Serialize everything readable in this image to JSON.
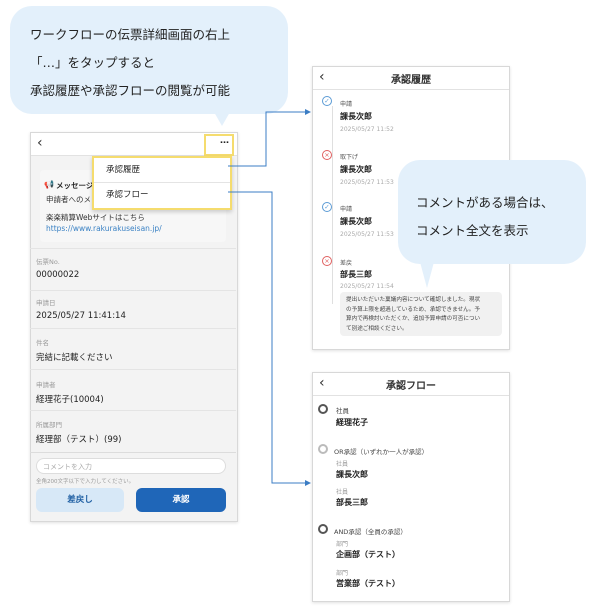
{
  "callouts": {
    "top": [
      "ワークフローの伝票詳細画面の右上",
      "「…」をタップすると",
      "承認履歴や承認フローの閲覧が可能"
    ],
    "right": [
      "コメントがある場合は、",
      "コメント全文を表示"
    ]
  },
  "detail": {
    "back_icon": "‹",
    "more_label": "…",
    "menu": [
      "承認履歴",
      "承認フロー"
    ],
    "message_title": "メッセージ",
    "message_body": "申請者へのメッ",
    "message_note": "楽楽精算Webサイトはこちら",
    "message_link": "https://www.rakurakuseisan.jp/",
    "fields": [
      {
        "label": "伝票No.",
        "value": "00000022"
      },
      {
        "label": "申請日",
        "value": "2025/05/27 11:41:14"
      },
      {
        "label": "件名",
        "value": "完結に記載ください"
      },
      {
        "label": "申請者",
        "value": "経理花子(10004)"
      },
      {
        "label": "所属部門",
        "value": "経理部（テスト）(99)"
      }
    ],
    "comment_placeholder": "コメントを入力",
    "comment_hint": "全角200文字以下で入力してください。",
    "reject_button": "差戻し",
    "approve_button": "承認"
  },
  "history": {
    "title": "承認履歴",
    "back_icon": "‹",
    "entries": [
      {
        "status": "申請",
        "name": "課長次郎",
        "date": "2025/05/27 11:52",
        "icon": "check-circle-icon"
      },
      {
        "status": "取下げ",
        "name": "課長次郎",
        "date": "2025/05/27 11:53",
        "icon": "cross-circle-icon"
      },
      {
        "status": "申請",
        "name": "課長次郎",
        "date": "2025/05/27 11:53",
        "icon": "check-circle-icon"
      },
      {
        "status": "差戻",
        "name": "部長三郎",
        "date": "2025/05/27 11:54",
        "icon": "cross-circle-icon"
      }
    ],
    "comment": [
      "提出いただいた稟議内容について確認しました。現状",
      "の予算上限を超過しているため、承認できません。予",
      "算内で再検討いただくか、追加予算申請の可否につい",
      "て別途ご相談ください。"
    ]
  },
  "flow": {
    "title": "承認フロー",
    "back_icon": "‹",
    "steps": [
      {
        "head": "社員",
        "members": [
          {
            "role": "",
            "name": "経理花子"
          }
        ]
      },
      {
        "head": "OR承認（いずれか一人が承認）",
        "members": [
          {
            "role": "社員",
            "name": "課長次郎"
          },
          {
            "role": "社員",
            "name": "部長三郎"
          }
        ]
      },
      {
        "head": "AND承認（全員の承認）",
        "members": [
          {
            "role": "部門",
            "name": "企画部（テスト）"
          },
          {
            "role": "部門",
            "name": "営業部（テスト）"
          }
        ]
      }
    ]
  },
  "colors": {
    "accent": "#1f66b8",
    "highlight": "#f5dc6e",
    "bubble": "#e3f0fb",
    "arrow": "#3b7dc4"
  }
}
